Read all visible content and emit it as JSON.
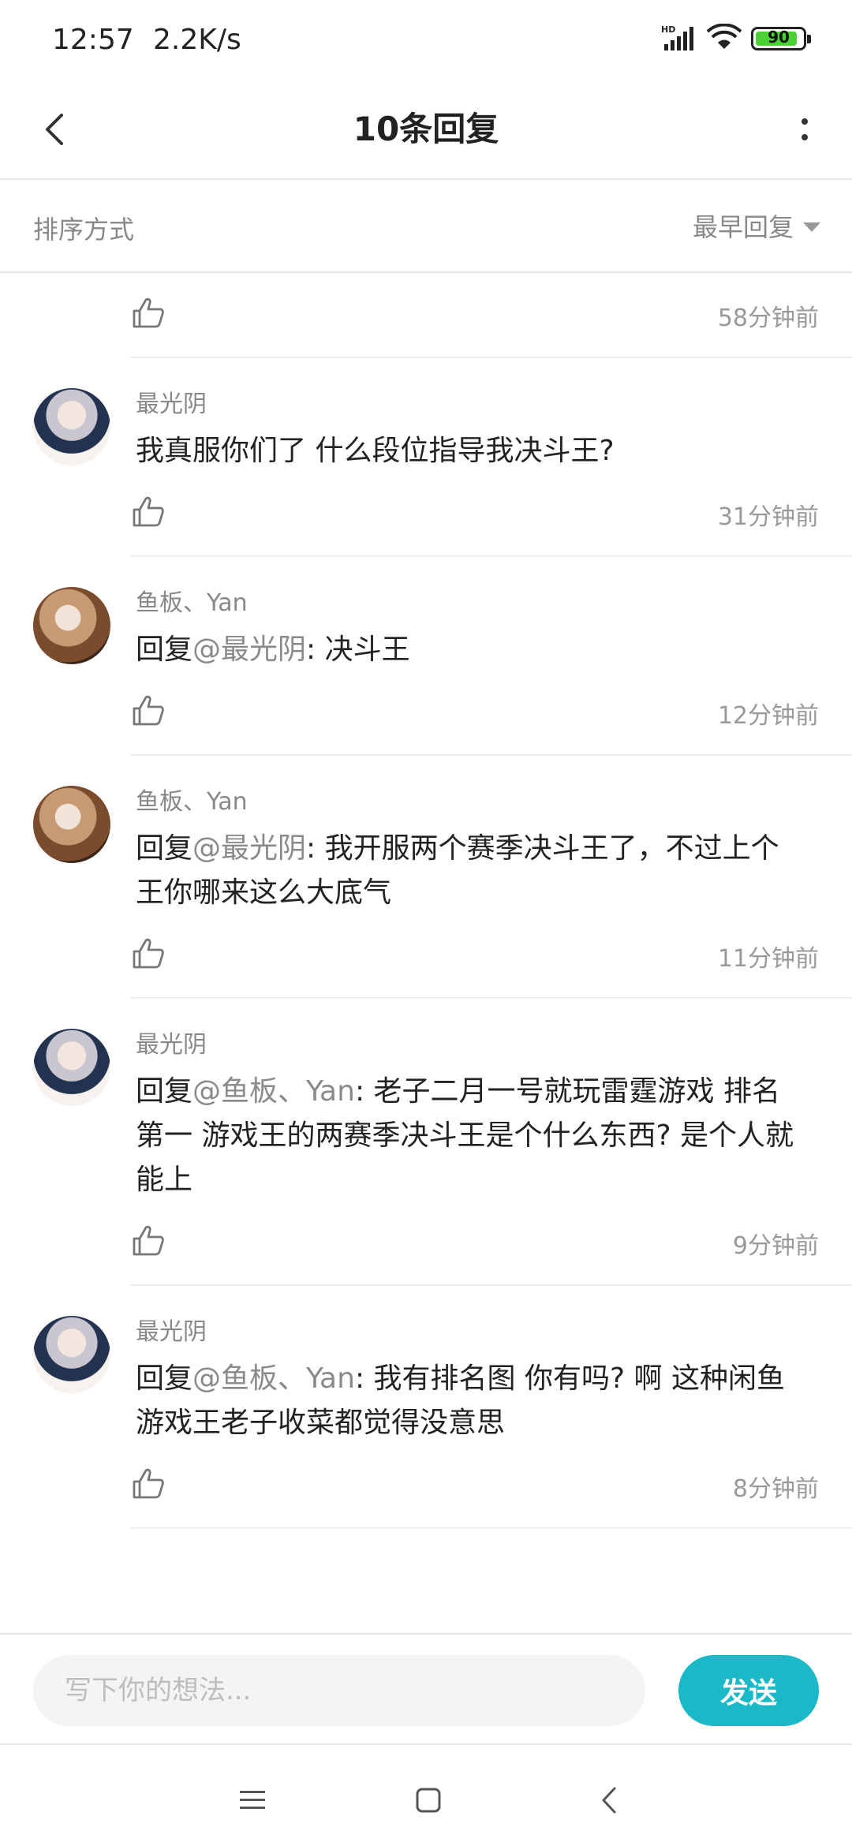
{
  "status_bar": {
    "time": "12:57",
    "net_speed": "2.2K/s",
    "battery": "90",
    "battery_level": 0.9,
    "icons": [
      "hd-signal-icon",
      "wifi-icon",
      "battery-icon"
    ]
  },
  "header": {
    "title": "10条回复",
    "back_icon": "chevron-left-icon",
    "more_icon": "more-vertical-icon"
  },
  "sort": {
    "label": "排序方式",
    "selected": "最早回复"
  },
  "first_row": {
    "time": "58分钟前"
  },
  "comments": [
    {
      "author": "最光阴",
      "prefix": "",
      "mention": "",
      "text": "我真服你们了 什么段位指导我决斗王?",
      "time": "31分钟前",
      "avatar": "a1"
    },
    {
      "author": "鱼板、Yan",
      "prefix": "回复",
      "mention": "@最光阴",
      "text": ": 决斗王",
      "time": "12分钟前",
      "avatar": "a2"
    },
    {
      "author": "鱼板、Yan",
      "prefix": "回复",
      "mention": "@最光阴",
      "text": ": 我开服两个赛季决斗王了，不过上个王你哪来这么大底气",
      "time": "11分钟前",
      "avatar": "a2"
    },
    {
      "author": "最光阴",
      "prefix": "回复",
      "mention": "@鱼板、Yan",
      "text": ": 老子二月一号就玩雷霆游戏 排名第一 游戏王的两赛季决斗王是个什么东西? 是个人就能上",
      "time": "9分钟前",
      "avatar": "a1"
    },
    {
      "author": "最光阴",
      "prefix": "回复",
      "mention": "@鱼板、Yan",
      "text": ": 我有排名图 你有吗? 啊 这种闲鱼游戏王老子收菜都觉得没意思",
      "time": "8分钟前",
      "avatar": "a1"
    }
  ],
  "input": {
    "placeholder": "写下你的想法...",
    "send_label": "发送"
  },
  "nav": {
    "icons": [
      "menu-icon",
      "home-square-icon",
      "back-triangle-icon"
    ]
  },
  "colors": {
    "accent": "#1bb8c8",
    "muted_text": "#888888",
    "battery_green": "#4cd137"
  }
}
